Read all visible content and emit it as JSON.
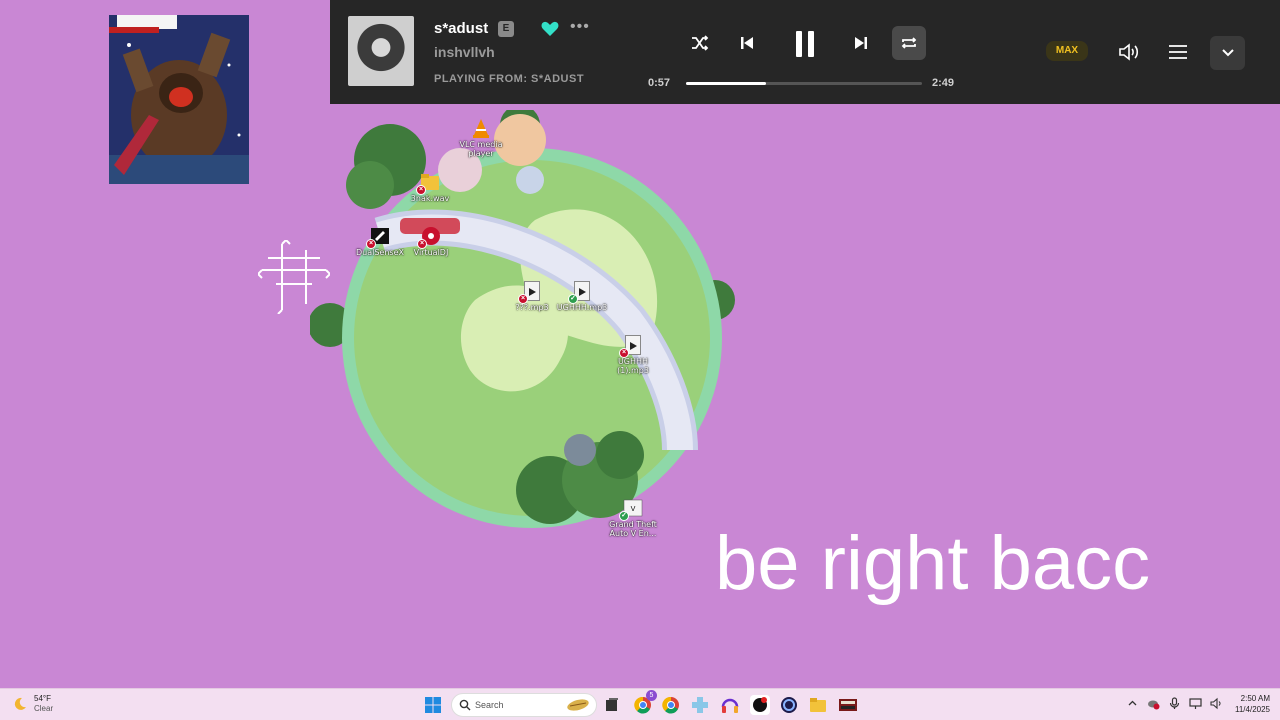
{
  "player": {
    "track_title": "s*adust",
    "explicit_label": "E",
    "artist": "inshvllvh",
    "playing_from": "PLAYING FROM: S*ADUST",
    "time_elapsed": "0:57",
    "time_total": "2:49",
    "progress_fraction": 0.34,
    "quality_badge": "MAX",
    "more_label": "•••",
    "accent_color": "#33e0c8"
  },
  "desktop_icons": [
    {
      "label": "VLC media player",
      "name": "vlc-icon",
      "status": "shortcut"
    },
    {
      "label": "3nak.wav",
      "name": "folder-icon",
      "status": "error"
    },
    {
      "label": "DualSenseX",
      "name": "dualsensex-icon",
      "status": "error"
    },
    {
      "label": "VirtualDJ",
      "name": "virtualdj-icon",
      "status": "error"
    },
    {
      "label": "???.mp3",
      "name": "audio-file-icon",
      "status": "error"
    },
    {
      "label": "UGHHH.mp3",
      "name": "audio-file-icon",
      "status": "ok"
    },
    {
      "label": "UGHHH (1).mp3",
      "name": "audio-file-icon",
      "status": "error"
    },
    {
      "label": "Grand Theft Auto V En...",
      "name": "gta-icon",
      "status": "ok"
    }
  ],
  "brb_text": "be right bacc",
  "taskbar": {
    "weather_temp": "54°F",
    "weather_condition": "Clear",
    "search_placeholder": "Search",
    "clock_time": "2:50 AM",
    "clock_date": "11/4/2025",
    "chrome_badge": "5"
  },
  "colors": {
    "background": "#c987d4",
    "player_bg": "#262626",
    "taskbar_bg": "#f3dff1"
  }
}
